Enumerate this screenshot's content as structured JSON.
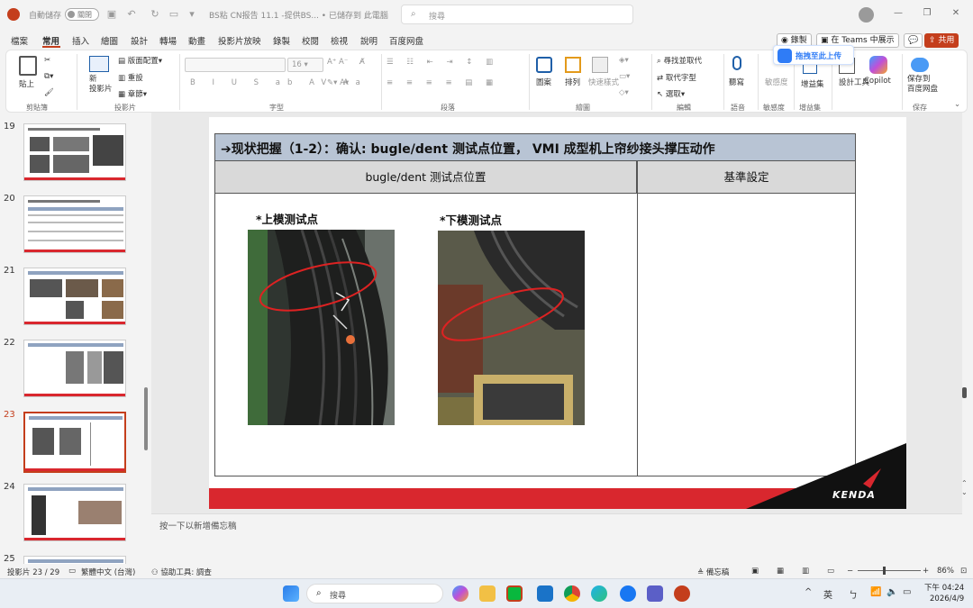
{
  "titlebar": {
    "autosave_label": "自動儲存",
    "toggle_label": "關閉",
    "doc_title": "BS粘 CN报告 11.1 -提供BS... • 已儲存到 此電腦",
    "search_placeholder": "搜尋"
  },
  "menu": {
    "tabs": [
      "檔案",
      "常用",
      "插入",
      "繪圖",
      "設計",
      "轉場",
      "動畫",
      "投影片放映",
      "錄製",
      "校閱",
      "檢視",
      "說明",
      "百度网盘"
    ],
    "active": "常用",
    "record_btn": "錄製",
    "teams_btn": "在 Teams 中展示",
    "share_btn": "共用"
  },
  "ribbon": {
    "paste": "貼上",
    "clipboard_group": "剪貼簿",
    "new_slide": "新\n投影片",
    "layout": "版面配置",
    "reset": "重設",
    "section": "章節",
    "slides_group": "投影片",
    "font_size": "16",
    "font_group": "字型",
    "paragraph_group": "段落",
    "shapes": "圖案",
    "arrange": "排列",
    "quick_styles": "快速樣式",
    "drawing_group": "繪圖",
    "find": "尋找並取代",
    "replace": "取代字型",
    "select": "選取",
    "editing_group": "編輯",
    "dictate": "聽寫",
    "voice_group": "語音",
    "sensitivity": "敏感度",
    "sensitivity_group": "敏感度",
    "addins": "增益集",
    "addins_group": "增益集",
    "designer": "設計工具",
    "copilot": "Copilot",
    "save_baidu": "保存到\n百度网盘",
    "save_group": "保存",
    "cloud_tip": "拖拽至此上传"
  },
  "thumbnails": [
    {
      "num": "19",
      "active": false
    },
    {
      "num": "20",
      "active": false
    },
    {
      "num": "21",
      "active": false
    },
    {
      "num": "22",
      "active": false
    },
    {
      "num": "23",
      "active": true
    },
    {
      "num": "24",
      "active": false
    },
    {
      "num": "25",
      "active": false
    }
  ],
  "slide": {
    "header": "➔现状把握（1-2）：确认: bugle/dent  测试点位置， VMI 成型机上帘纱接头撑压动作",
    "col1_header": "bugle/dent  测试点位置",
    "col2_header": "基準設定",
    "caption_upper": "*上模测试点",
    "caption_lower": "*下模测试点",
    "logo_text": "KENDA"
  },
  "notes_placeholder": "按一下以新增備忘稿",
  "statusbar": {
    "slide_count": "投影片 23 / 29",
    "language": "繁體中文 (台灣)",
    "accessibility": "協助工具: 調查",
    "notes_btn": "備忘稿",
    "zoom": "86%"
  },
  "taskbar": {
    "search_placeholder": "搜尋",
    "ime": "英",
    "time": "下午 04:24",
    "date": "2026/4/9"
  },
  "colors": {
    "accent": "#c43e1c",
    "kenda_red": "#d9272e",
    "header_blue": "#b8c4d4"
  }
}
